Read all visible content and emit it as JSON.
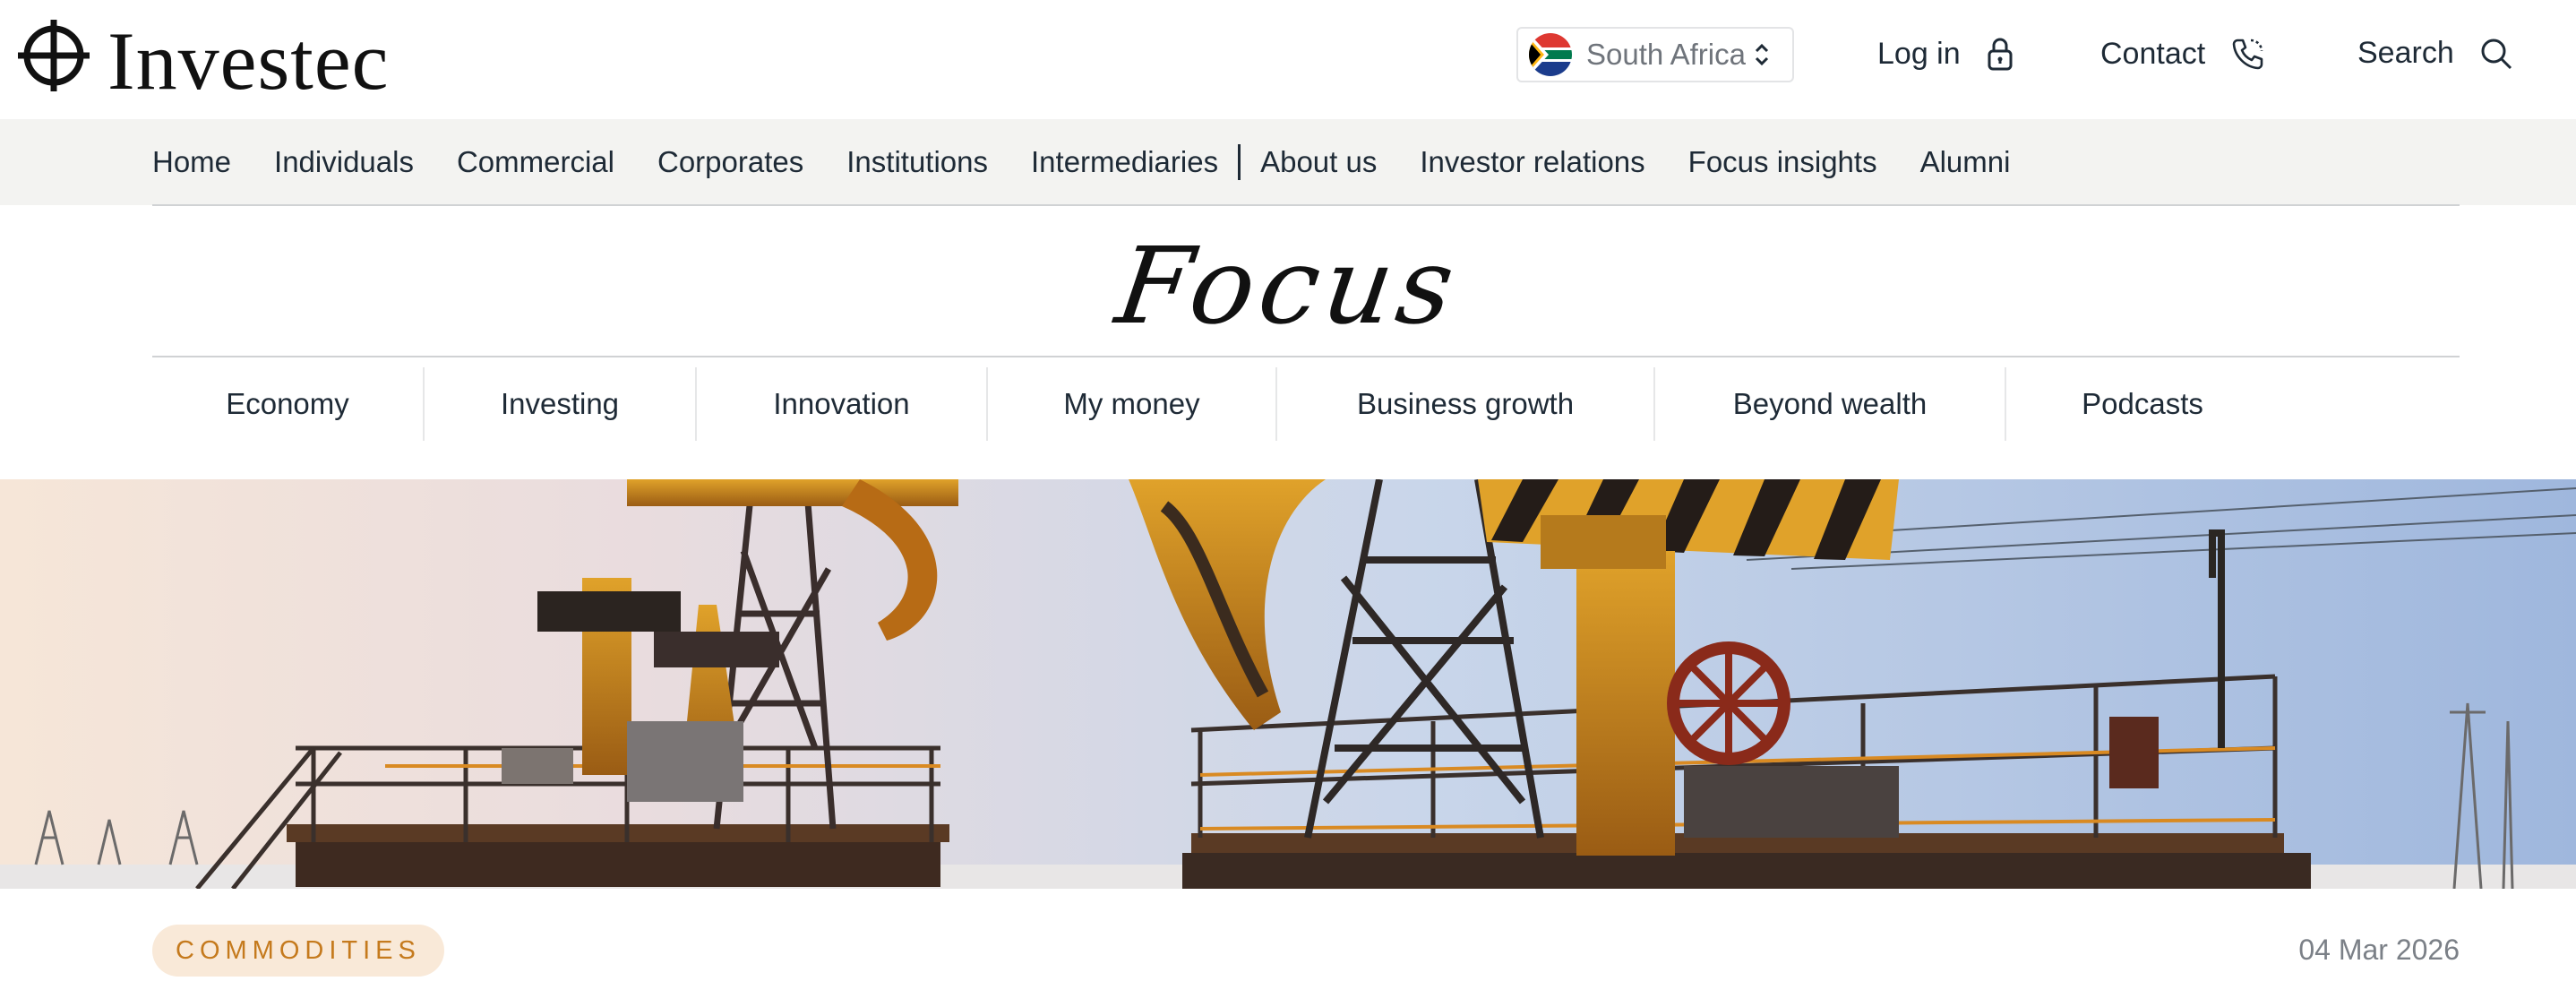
{
  "brand": {
    "name": "Investec"
  },
  "region": {
    "label": "South Africa",
    "flag_icon": "south-africa-flag-icon"
  },
  "utility_nav": [
    {
      "label": "Log in",
      "icon": "lock-icon"
    },
    {
      "label": "Contact",
      "icon": "phone-icon"
    },
    {
      "label": "Search",
      "icon": "search-icon"
    }
  ],
  "main_nav": {
    "items": [
      "Home",
      "Individuals",
      "Commercial",
      "Corporates",
      "Institutions",
      "Intermediaries"
    ],
    "secondary_items": [
      "About us",
      "Investor relations",
      "Focus insights",
      "Alumni"
    ]
  },
  "focus": {
    "title": "Focus",
    "categories": [
      "Economy",
      "Investing",
      "Innovation",
      "My money",
      "Business growth",
      "Beyond wealth",
      "Podcasts"
    ]
  },
  "article": {
    "tag": "COMMODITIES",
    "date": "04 Mar 2026",
    "hero_image": "oil-pumpjacks-image"
  },
  "colors": {
    "nav_background": "#f3f3f1",
    "tag_background": "#f9e9d8",
    "tag_text": "#c57a1d",
    "text": "#1e2a36"
  }
}
